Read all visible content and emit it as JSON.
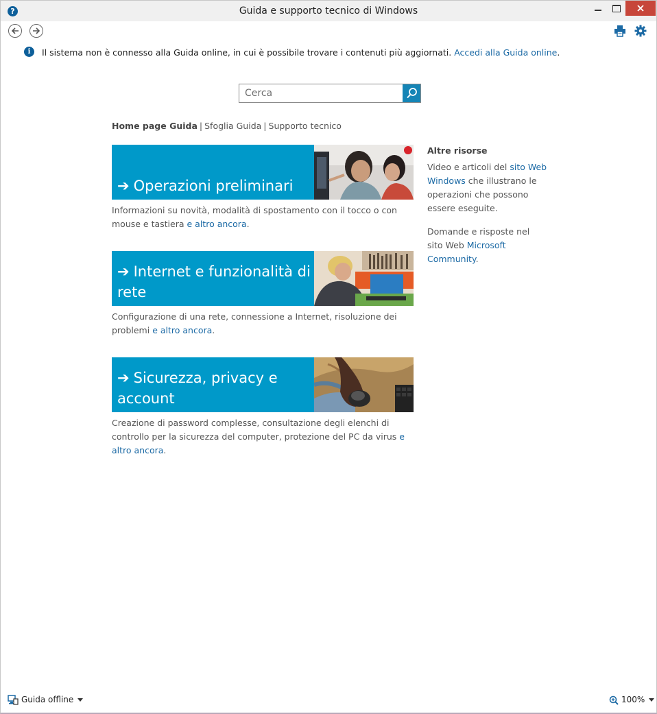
{
  "window": {
    "title": "Guida e supporto tecnico di Windows",
    "help_glyph": "?"
  },
  "info_bar": {
    "icon": "info-icon",
    "message": "Il sistema non è connesso alla Guida online, in cui è possibile trovare i contenuti più aggiornati.",
    "link": "Accedi alla Guida online",
    "end": "."
  },
  "search": {
    "placeholder": "Cerca"
  },
  "breadcrumb": {
    "home": "Home page Guida",
    "sep1": "|",
    "browse": "Sfoglia Guida",
    "sep2": "|",
    "support": "Supporto tecnico"
  },
  "tiles": [
    {
      "arrow": "➔",
      "title": "Operazioni preliminari",
      "desc": "Informazioni su novità, modalità di spostamento con il tocco o con mouse e tastiera",
      "link": "e altro ancora",
      "end": "."
    },
    {
      "arrow": "➔",
      "title": "Internet e funzionalità di rete",
      "desc": "Configurazione di una rete, connessione a Internet, risoluzione dei problemi",
      "link": "e altro ancora",
      "end": "."
    },
    {
      "arrow": "➔",
      "title": "Sicurezza, privacy e account",
      "desc": "Creazione di password complesse, consultazione degli elenchi di controllo per la sicurezza del computer, protezione del PC da virus",
      "link": "e altro ancora",
      "end": "."
    }
  ],
  "sidebar": {
    "title": "Altre risorse",
    "p1_text": "Video e articoli del",
    "p1_link": "sito Web Windows",
    "p1_end": "che illustrano le operazioni che possono essere eseguite.",
    "p2_text": "Domande e risposte nel sito Web",
    "p2_link": "Microsoft Community",
    "p2_end": "."
  },
  "status": {
    "mode": "Guida offline",
    "zoom": "100%"
  },
  "colors": {
    "tile": "#0099c9",
    "link": "#1c6aa5",
    "close": "#c7463a"
  }
}
